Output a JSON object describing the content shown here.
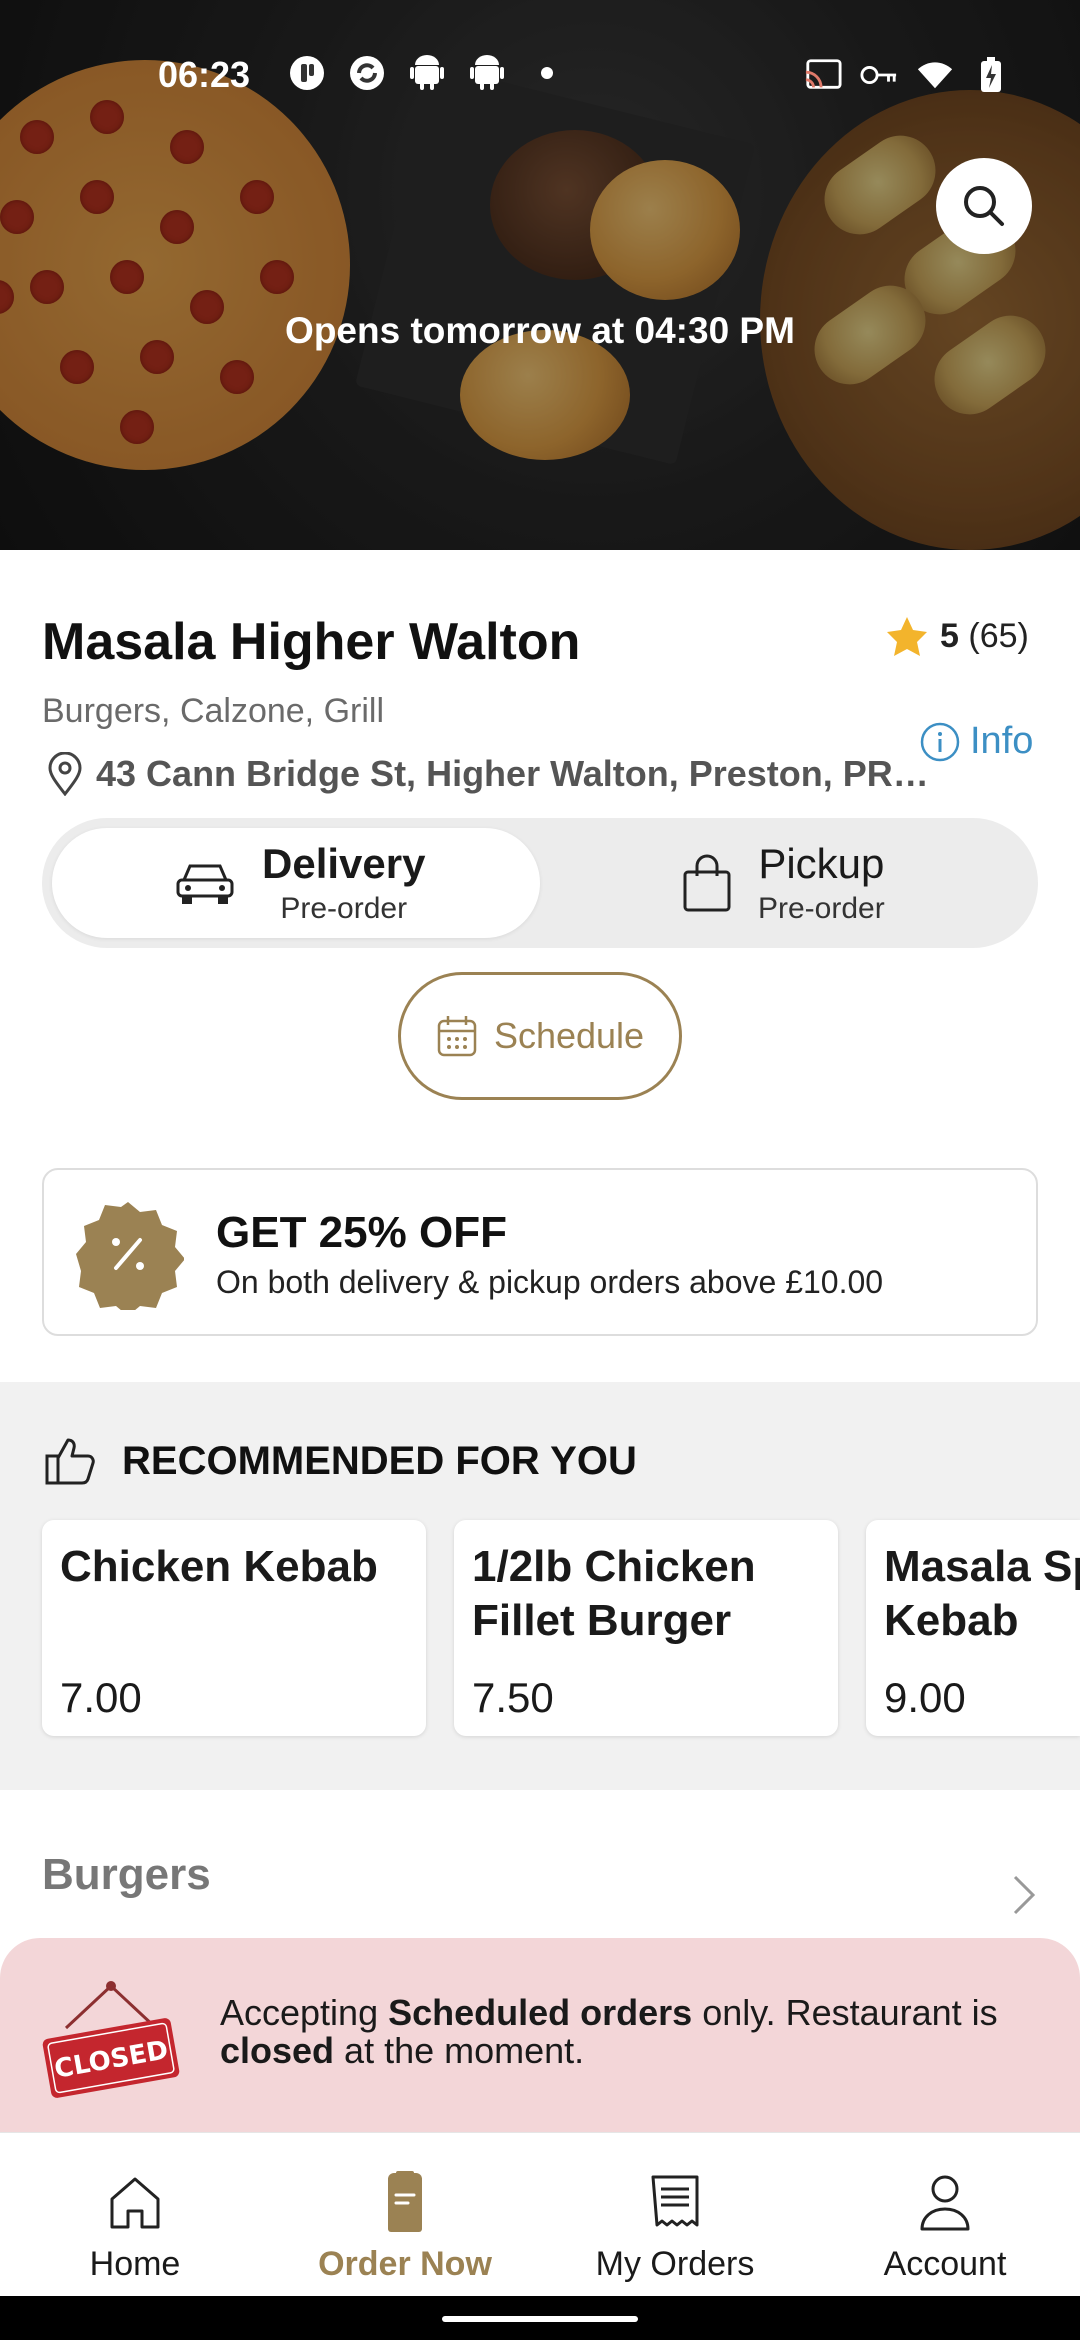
{
  "status_bar": {
    "time": "06:23"
  },
  "hero": {
    "status_text": "Opens tomorrow at 04:30 PM"
  },
  "restaurant": {
    "name": "Masala Higher Walton",
    "rating": "5",
    "rating_count": "(65)",
    "cuisines": "Burgers, Calzone, Grill",
    "info_label": "Info",
    "address": "43 Cann Bridge St, Higher Walton, Preston, PR…"
  },
  "order_modes": {
    "delivery": {
      "label": "Delivery",
      "sub": "Pre-order",
      "selected": true
    },
    "pickup": {
      "label": "Pickup",
      "sub": "Pre-order",
      "selected": false
    }
  },
  "schedule_label": "Schedule",
  "promo": {
    "title": "GET 25% OFF",
    "subtitle": "On both delivery & pickup orders above £10.00"
  },
  "recommended": {
    "heading": "RECOMMENDED FOR YOU",
    "items": [
      {
        "name": "Chicken Kebab",
        "price": "7.00"
      },
      {
        "name": "1/2lb Chicken Fillet Burger M…",
        "price": "7.50"
      },
      {
        "name": "Masala Sp Kebab",
        "price": "9.00"
      }
    ]
  },
  "category": {
    "title": "Burgers"
  },
  "closed_banner": {
    "sign_text": "CLOSED",
    "part1": "Accepting ",
    "bold1": "Scheduled orders",
    "part2": " only. Restaurant is",
    "bold2": "closed",
    "part3": " at the moment."
  },
  "bottom_nav": {
    "items": [
      {
        "label": "Home",
        "icon": "home-icon"
      },
      {
        "label": "Order Now",
        "icon": "order-now-icon",
        "active": true
      },
      {
        "label": "My Orders",
        "icon": "receipt-icon"
      },
      {
        "label": "Account",
        "icon": "person-icon"
      }
    ]
  },
  "colors": {
    "accent_gold": "#9b8253",
    "info_blue": "#3c8fc4",
    "closed_banner_bg": "#f3d6d8",
    "star": "#f3b42c"
  }
}
